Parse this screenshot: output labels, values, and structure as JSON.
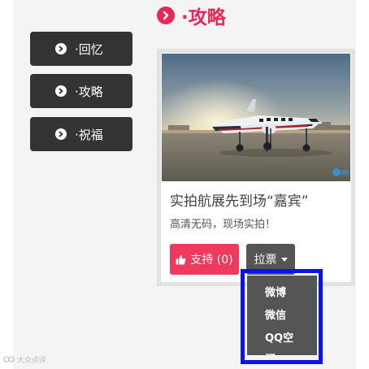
{
  "header": {
    "title": "·攻略"
  },
  "sidebar": {
    "items": [
      {
        "label": "·回忆"
      },
      {
        "label": "·攻略"
      },
      {
        "label": "·祝福"
      }
    ]
  },
  "card": {
    "title": "实拍航展先到场“嘉宾”",
    "description": "高清无码，现场实拍！",
    "support_label": "支持 (0)",
    "vote_label": "拉票"
  },
  "share_menu": {
    "items": [
      {
        "label": "微博"
      },
      {
        "label": "微信"
      },
      {
        "label": "QQ空"
      },
      {
        "label": "间"
      }
    ]
  },
  "watermark": {
    "text": "大众点评"
  },
  "colors": {
    "accent": "#e8265a",
    "support_button": "#ee3a5c",
    "nav_button": "#333333",
    "dropdown": "#555555",
    "highlight": "#0c14e4"
  }
}
